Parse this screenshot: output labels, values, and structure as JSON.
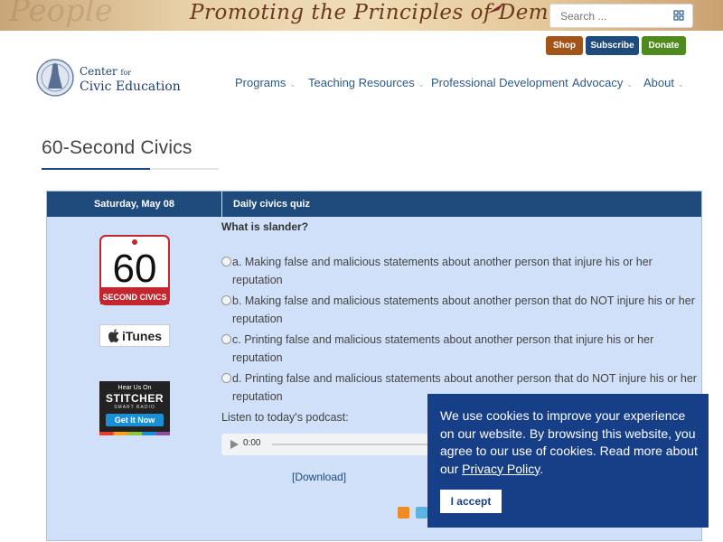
{
  "banner": {
    "slogan": "Promoting the Principles of Democracy",
    "ghost_text": "People"
  },
  "search": {
    "placeholder": "Search ..."
  },
  "actions": {
    "shop": "Shop",
    "subscribe": "Subscribe",
    "donate": "Donate"
  },
  "logo": {
    "line1_main": "Center",
    "line1_small": "for",
    "line2": "Civic Education"
  },
  "nav": [
    {
      "label": "Programs",
      "has_dropdown": true
    },
    {
      "label": "Teaching Resources",
      "has_dropdown": true
    },
    {
      "label": "Professional Development",
      "has_dropdown": false
    },
    {
      "label": "Advocacy",
      "has_dropdown": true
    },
    {
      "label": "About",
      "has_dropdown": true
    }
  ],
  "page": {
    "title": "60-Second Civics"
  },
  "box": {
    "date": "Saturday, May 08",
    "quiz_header": "Daily civics quiz",
    "badge_number": "60",
    "badge_caption": "SECOND CIVICS",
    "itunes": "iTunes",
    "stitcher": {
      "line1": "Hear Us On",
      "line2": "STITCHER",
      "line3": "SMART RADIO",
      "button": "Get It Now"
    },
    "question": "What is slander?",
    "options": [
      {
        "line1": "a. Making false and malicious statements about another person that injure his or her",
        "line2": "reputation"
      },
      {
        "line1": "b. Making false and malicious statements about another person that do NOT injure his or her",
        "line2": "reputation"
      },
      {
        "line1": "c. Printing false and malicious statements about another person that injure his or her",
        "line2": "reputation"
      },
      {
        "line1": "d. Printing false and malicious statements about another person that do NOT injure his or her",
        "line2": "reputation"
      }
    ],
    "listen": "Listen to today's podcast:",
    "player_time": "0:00",
    "download": "[Download]"
  },
  "cookie": {
    "message": "We use cookies to improve your experience on our website. By browsing this website, you agree to our use of cookies. Read more about our",
    "link": "Privacy Policy",
    "end": ".",
    "accept": "I accept"
  },
  "colors": {
    "navy": "#1e4a7c",
    "box_bg": "#cfe0f8",
    "shop": "#a3541b",
    "donate": "#4f8a1e",
    "cookie_bg": "#163f88"
  }
}
